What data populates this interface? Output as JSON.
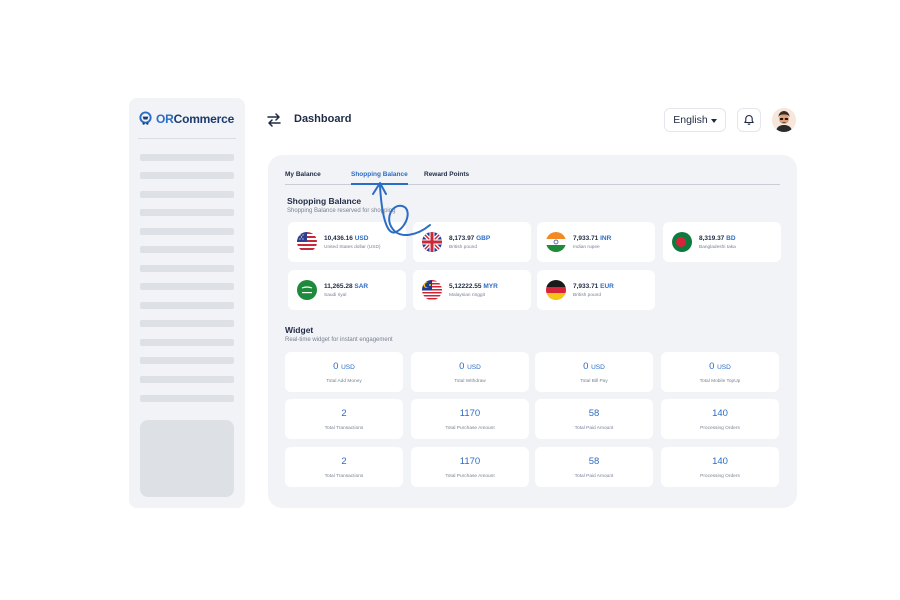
{
  "app": {
    "logo_prefix": "OR",
    "logo_suffix": "Commerce"
  },
  "header": {
    "title": "Dashboard",
    "language": "English"
  },
  "tabs": [
    {
      "label": "My Balance",
      "active": false
    },
    {
      "label": "Shopping Balance",
      "active": true
    },
    {
      "label": "Reward Points",
      "active": false
    }
  ],
  "shopping": {
    "title": "Shopping Balance",
    "subtitle": "Shopping Balance reserved for shopping",
    "balances": [
      {
        "amount": "10,436.16",
        "currency": "USD",
        "name": "United States dollar (USD)",
        "flag": "us-flag-icon"
      },
      {
        "amount": "8,173.97",
        "currency": "GBP",
        "name": "British pound",
        "flag": "uk-flag-icon"
      },
      {
        "amount": "7,933.71",
        "currency": "INR",
        "name": "Indian rupee",
        "flag": "india-flag-icon"
      },
      {
        "amount": "8,319.37",
        "currency": "BD",
        "name": "Bangladeshi taka",
        "flag": "bangladesh-flag-icon"
      },
      {
        "amount": "11,265.28",
        "currency": "SAR",
        "name": "Saudi riyal",
        "flag": "saudi-flag-icon"
      },
      {
        "amount": "5,12222.55",
        "currency": "MYR",
        "name": "Malaysian ringgit",
        "flag": "malaysia-flag-icon"
      },
      {
        "amount": "7,933.71",
        "currency": "EUR",
        "name": "British pound",
        "flag": "germany-flag-icon"
      }
    ]
  },
  "widget": {
    "title": "Widget",
    "subtitle": "Real-time widget for instant engagement",
    "rows": [
      [
        {
          "value": "0",
          "unit": "USD",
          "label": "Total Add Money"
        },
        {
          "value": "0",
          "unit": "USD",
          "label": "Total Withdraw"
        },
        {
          "value": "0",
          "unit": "USD",
          "label": "Total Bill Pay"
        },
        {
          "value": "0",
          "unit": "USD",
          "label": "Total Mobile TopUp"
        }
      ],
      [
        {
          "value": "2",
          "unit": "",
          "label": "Total Transactions"
        },
        {
          "value": "1170",
          "unit": "",
          "label": "Total Purchase Amount"
        },
        {
          "value": "58",
          "unit": "",
          "label": "Total Paid Amount"
        },
        {
          "value": "140",
          "unit": "",
          "label": "Processing Orders"
        }
      ],
      [
        {
          "value": "2",
          "unit": "",
          "label": "Total Transactions"
        },
        {
          "value": "1170",
          "unit": "",
          "label": "Total Purchase Amount"
        },
        {
          "value": "58",
          "unit": "",
          "label": "Total Paid Amount"
        },
        {
          "value": "140",
          "unit": "",
          "label": "Processing Orders"
        }
      ]
    ]
  },
  "colors": {
    "accent": "#2b6cc4",
    "brand_dark": "#1d3a6e",
    "panel": "#f1f3f6",
    "card": "#ffffff"
  }
}
